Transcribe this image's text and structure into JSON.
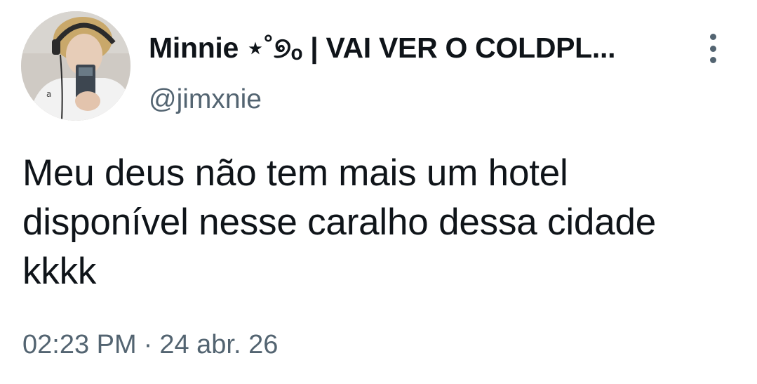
{
  "tweet": {
    "display_name": "Minnie ⋆˚୭ₒ | VAI VER O COLDPL...",
    "handle": "@jimxnie",
    "text": "Meu deus não tem mais um hotel disponível nesse caralho dessa cidade kkkk",
    "time": "02:23 PM",
    "separator": "·",
    "date": "24 abr. 26"
  },
  "icons": {
    "menu": "more-vertical-icon",
    "avatar": "profile-avatar"
  },
  "colors": {
    "text_primary": "#0f1419",
    "text_secondary": "#536471",
    "background": "#ffffff"
  }
}
